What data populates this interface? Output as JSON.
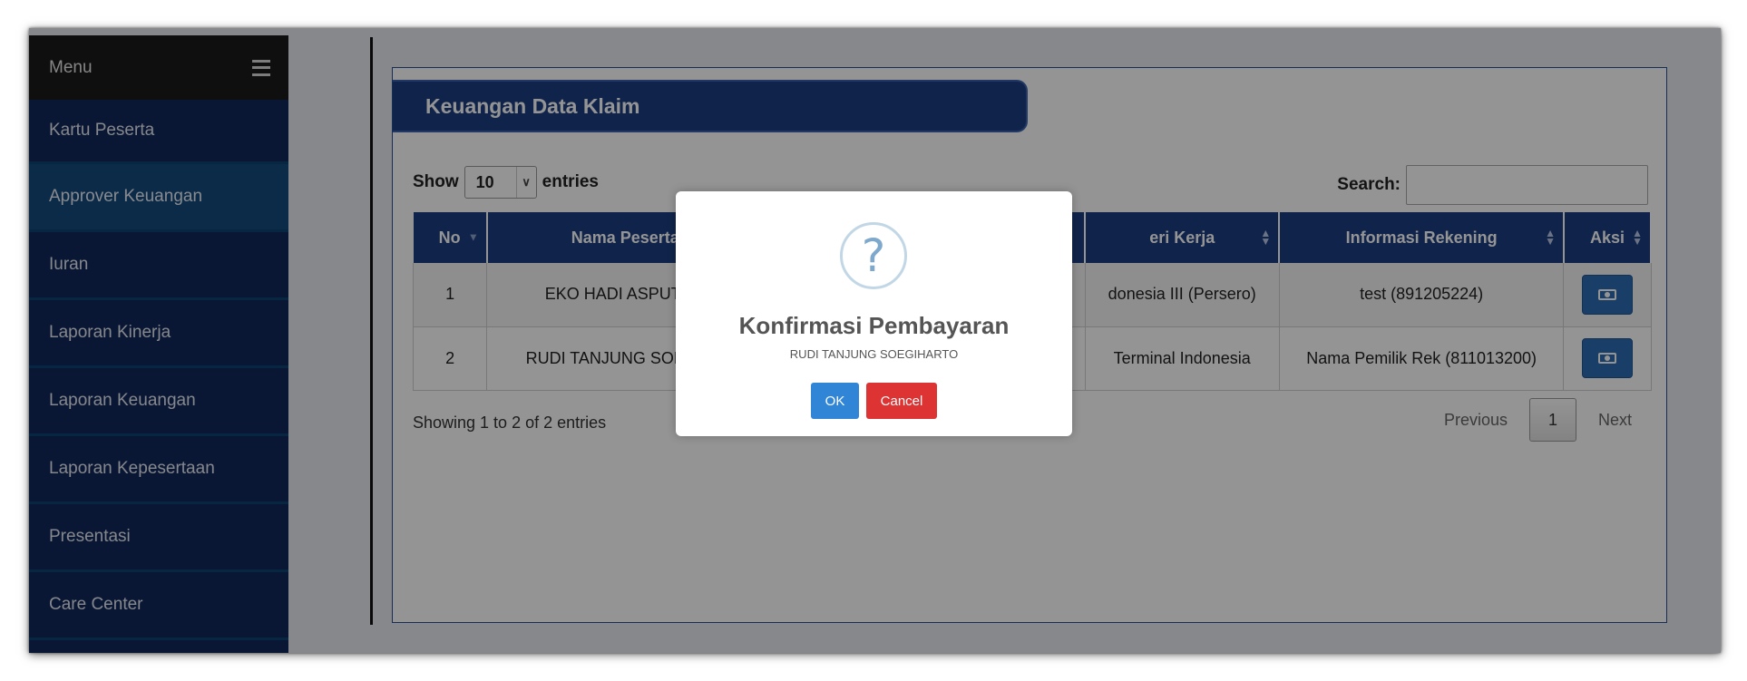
{
  "sidebar": {
    "menu_label": "Menu",
    "items": [
      {
        "label": "Kartu Peserta",
        "active": false
      },
      {
        "label": "Approver Keuangan",
        "active": true
      },
      {
        "label": "Iuran",
        "active": false
      },
      {
        "label": "Laporan Kinerja",
        "active": false
      },
      {
        "label": "Laporan Keuangan",
        "active": false
      },
      {
        "label": "Laporan Kepesertaan",
        "active": false
      },
      {
        "label": "Presentasi",
        "active": false
      },
      {
        "label": "Care Center",
        "active": false
      }
    ]
  },
  "panel": {
    "title": "Keuangan Data Klaim",
    "show_label": "Show",
    "entries_value": "10",
    "entries_label": "entries",
    "search_label": "Search:",
    "search_value": ""
  },
  "table": {
    "headers": [
      "No",
      "Nama Peserta",
      "",
      "eri Kerja",
      "Informasi Rekening",
      "Aksi"
    ],
    "rows": [
      {
        "no": "1",
        "nama": "EKO HADI ASPUTRO",
        "mid": "",
        "kerja": "donesia III (Persero)",
        "rekening": "test (891205224)"
      },
      {
        "no": "2",
        "nama": "RUDI TANJUNG SOEGIHA",
        "mid": "",
        "kerja": "Terminal Indonesia",
        "rekening": "Nama Pemilik Rek (811013200)"
      }
    ]
  },
  "footer": {
    "info": "Showing 1 to 2 of 2 entries",
    "previous": "Previous",
    "page": "1",
    "next": "Next"
  },
  "dialog": {
    "icon": "?",
    "title": "Konfirmasi Pembayaran",
    "text": "RUDI TANJUNG SOEGIHARTO",
    "ok": "OK",
    "cancel": "Cancel"
  },
  "colors": {
    "navy": "#12285a",
    "header_blue": "#1c3f82",
    "ok_blue": "#3085d6",
    "cancel_red": "#dd3333"
  }
}
